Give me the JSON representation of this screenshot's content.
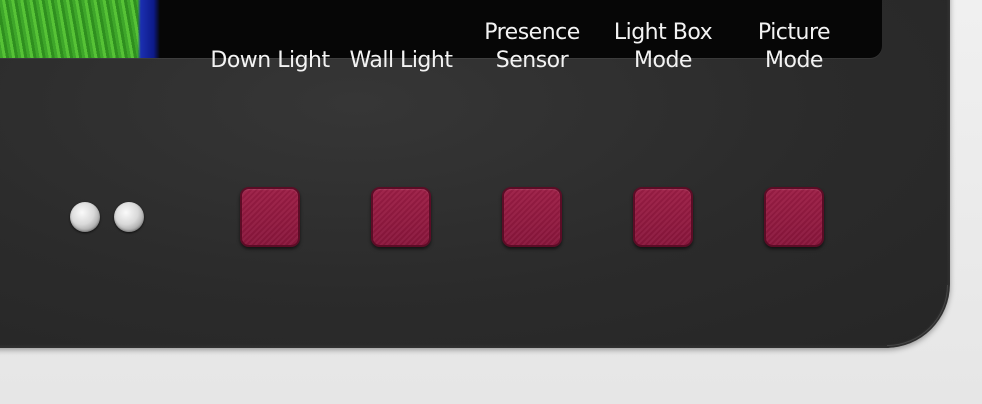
{
  "controls": [
    {
      "id": "down-light",
      "label": "Down Light"
    },
    {
      "id": "wall-light",
      "label": "Wall Light"
    },
    {
      "id": "presence-sensor",
      "label": "Presence\nSensor"
    },
    {
      "id": "light-box-mode",
      "label": "Light Box\nMode"
    },
    {
      "id": "picture-mode",
      "label": "Picture\nMode"
    }
  ],
  "colors": {
    "bezel": "#2e2e2e",
    "button": "#8e1840",
    "label_text": "#f3f3f3",
    "background": "#e9e9e9"
  }
}
